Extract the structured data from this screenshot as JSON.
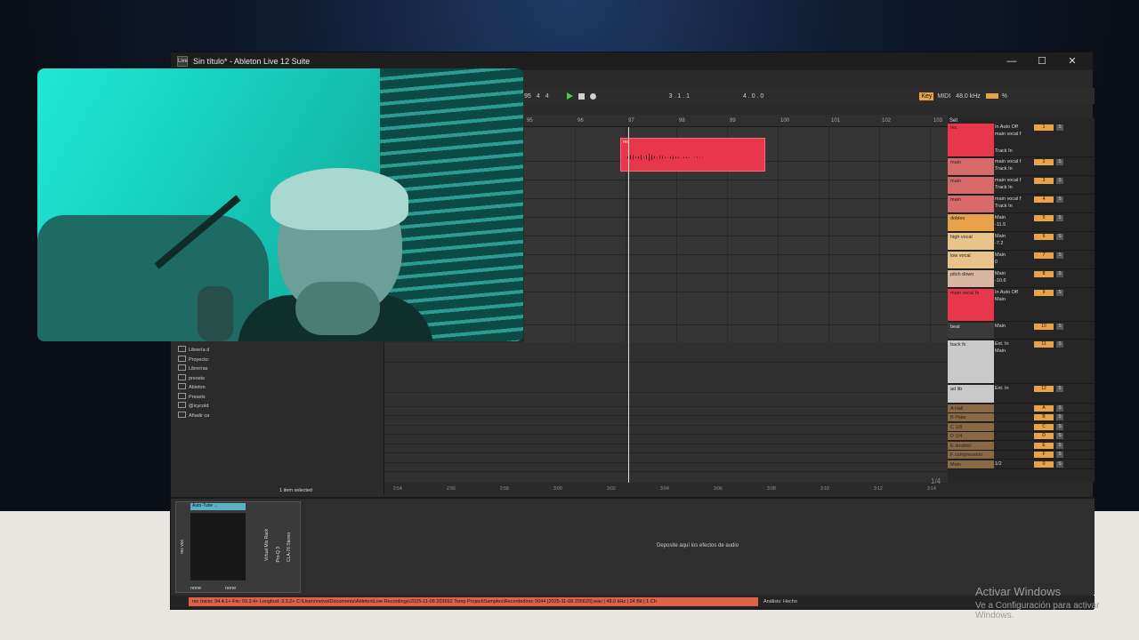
{
  "window": {
    "title": "Sin título* - Ableton Live 12 Suite",
    "app_icon": "Live"
  },
  "controls": {
    "minimize": "—",
    "maximize": "☐",
    "close": "✕"
  },
  "transport": {
    "tempo": "95",
    "sig_num": "4",
    "sig_den": "4",
    "position": "3 . 1 . 1",
    "end_position": "4 . 0 . 0",
    "key_label": "Key",
    "midi_label": "MIDI",
    "sample_rate": "48.0 kHz",
    "cpu": "%"
  },
  "ruler": [
    "95",
    "96",
    "97",
    "98",
    "99",
    "100",
    "101",
    "102",
    "103"
  ],
  "set_label": "Set",
  "clip": {
    "label": "rec"
  },
  "tracks": [
    {
      "name": "rec",
      "color": "#e8364a",
      "io1": "In  Auto  Off",
      "io2": "main vocal f",
      "io3": "Track In",
      "num": "1"
    },
    {
      "name": "main",
      "color": "#d96a6a",
      "io1": "main vocal f",
      "io2": "Track In",
      "num": "2"
    },
    {
      "name": "main",
      "color": "#d96a6a",
      "io1": "main vocal f",
      "io2": "Track In",
      "num": "3"
    },
    {
      "name": "main",
      "color": "#d96a6a",
      "io1": "main vocal f",
      "io2": "Track In",
      "num": "4"
    },
    {
      "name": "dobles",
      "color": "#e8a34a",
      "io1": "Main",
      "io2": "-11.5",
      "num": "5"
    },
    {
      "name": "high vocal",
      "color": "#e8c38a",
      "io1": "Main",
      "io2": "-7.2",
      "num": "6"
    },
    {
      "name": "low vocal",
      "color": "#e8c38a",
      "io1": "Main",
      "io2": "0",
      "num": "7"
    },
    {
      "name": "pitch down",
      "color": "#d8b6a0",
      "io1": "Main",
      "io2": "-10.6",
      "num": "8"
    },
    {
      "name": "main vocal fx",
      "color": "#e8364a",
      "io1": "In  Auto  Off",
      "io2": "Main",
      "num": "9"
    },
    {
      "name": "beat",
      "color": "#3a3a3a",
      "io1": "Main",
      "io2": "",
      "num": "10"
    },
    {
      "name": "back fx",
      "color": "#c9c9c9",
      "io1": "Ext. In",
      "io2": "Main",
      "num": "11"
    },
    {
      "name": "ad lib",
      "color": "#c9c9c9",
      "io1": "Ext. In",
      "io2": "",
      "num": "12"
    },
    {
      "name": "A Hall",
      "color": "#8a6a45",
      "io1": "",
      "io2": "",
      "num": "A"
    },
    {
      "name": "B Plate",
      "color": "#8a6a45",
      "io1": "",
      "io2": "",
      "num": "B"
    },
    {
      "name": "C 1/8",
      "color": "#8a6a45",
      "io1": "",
      "io2": "",
      "num": "C"
    },
    {
      "name": "D 1/4",
      "color": "#8a6a45",
      "io1": "",
      "io2": "",
      "num": "D"
    },
    {
      "name": "E doubler",
      "color": "#8a6a45",
      "io1": "",
      "io2": "",
      "num": "E"
    },
    {
      "name": "F compression",
      "color": "#8a6a45",
      "io1": "",
      "io2": "",
      "num": "F"
    },
    {
      "name": "Main",
      "color": "#8a6a45",
      "io1": "1/2",
      "io2": "",
      "num": "0"
    }
  ],
  "browser": {
    "items": [
      "Librería d",
      "Proyecto:",
      "Librerías",
      "presets",
      "Ableton",
      "Presets",
      "@icycold",
      "Añadir ca"
    ],
    "selection": "1 item selected"
  },
  "timeline2": [
    "2:54",
    "2:56",
    "2:58",
    "3:00",
    "3:02",
    "3:04",
    "3:06",
    "3:08",
    "3:10",
    "3:12",
    "3:14"
  ],
  "page_indicator": "1/4",
  "device": {
    "name": "Auto-Tune ...",
    "labels": [
      "rec voc",
      "Virtual Mix Rack",
      "Pro-Q 3",
      "CLA-76 Stereo"
    ],
    "none1": "none",
    "none2": "none",
    "drop_hint": "Deposite aquí los efectos de audio"
  },
  "status": {
    "path": "rec  Inicio: 94.4.1+  Fin: 99.3.4+  Longitud: 3.3.2+  C:\\Users\\neiva\\Documents\\Ableton\\Live Recordings\\2025-11-08 203652 Temp Project\\Samples\\Recorded\\rec 0044 [2025-11-08 205620].wav | 48.0 kHz | 24 Bit | 1 Ch",
    "analysis": "Análisis: Hecho"
  },
  "watermark": {
    "title": "Activar Windows",
    "sub": "Ve a Configuración para activar Windows."
  }
}
